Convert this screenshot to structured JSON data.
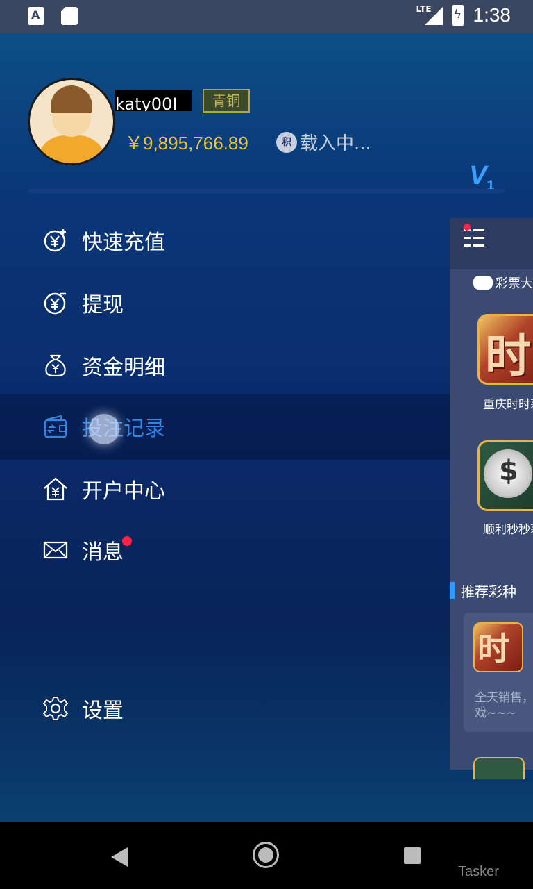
{
  "status_bar": {
    "time": "1:38",
    "network": "LTE"
  },
  "profile": {
    "username": "katy00I",
    "rank": "青铜",
    "balance": "￥9,895,766.89",
    "points_icon_label": "积",
    "points_text": "载入中...",
    "vip_level": "V",
    "vip_sub": "1"
  },
  "menu": {
    "items": [
      {
        "label": "快速充值",
        "icon": "yuan-plus-icon"
      },
      {
        "label": "提现",
        "icon": "yuan-minus-icon"
      },
      {
        "label": "资金明细",
        "icon": "money-bag-icon"
      },
      {
        "label": "投注记录",
        "icon": "wallet-icon"
      },
      {
        "label": "开户中心",
        "icon": "house-yuan-icon"
      },
      {
        "label": "消息",
        "icon": "envelope-icon"
      }
    ],
    "settings_label": "设置"
  },
  "peek": {
    "category_label": "彩票大",
    "game1_label": "重庆时时彩",
    "game1_glyph": "时",
    "game2_label": "顺利秒秒彩",
    "section_title": "推荐彩种",
    "rec_glyph": "时",
    "rec_desc_line1": "全天销售，",
    "rec_desc_line2": "戏~~~"
  },
  "watermark": "Tasker",
  "colors": {
    "accent": "#2e86e6",
    "balance": "#e9c441",
    "badge_dot": "#ff2244"
  }
}
